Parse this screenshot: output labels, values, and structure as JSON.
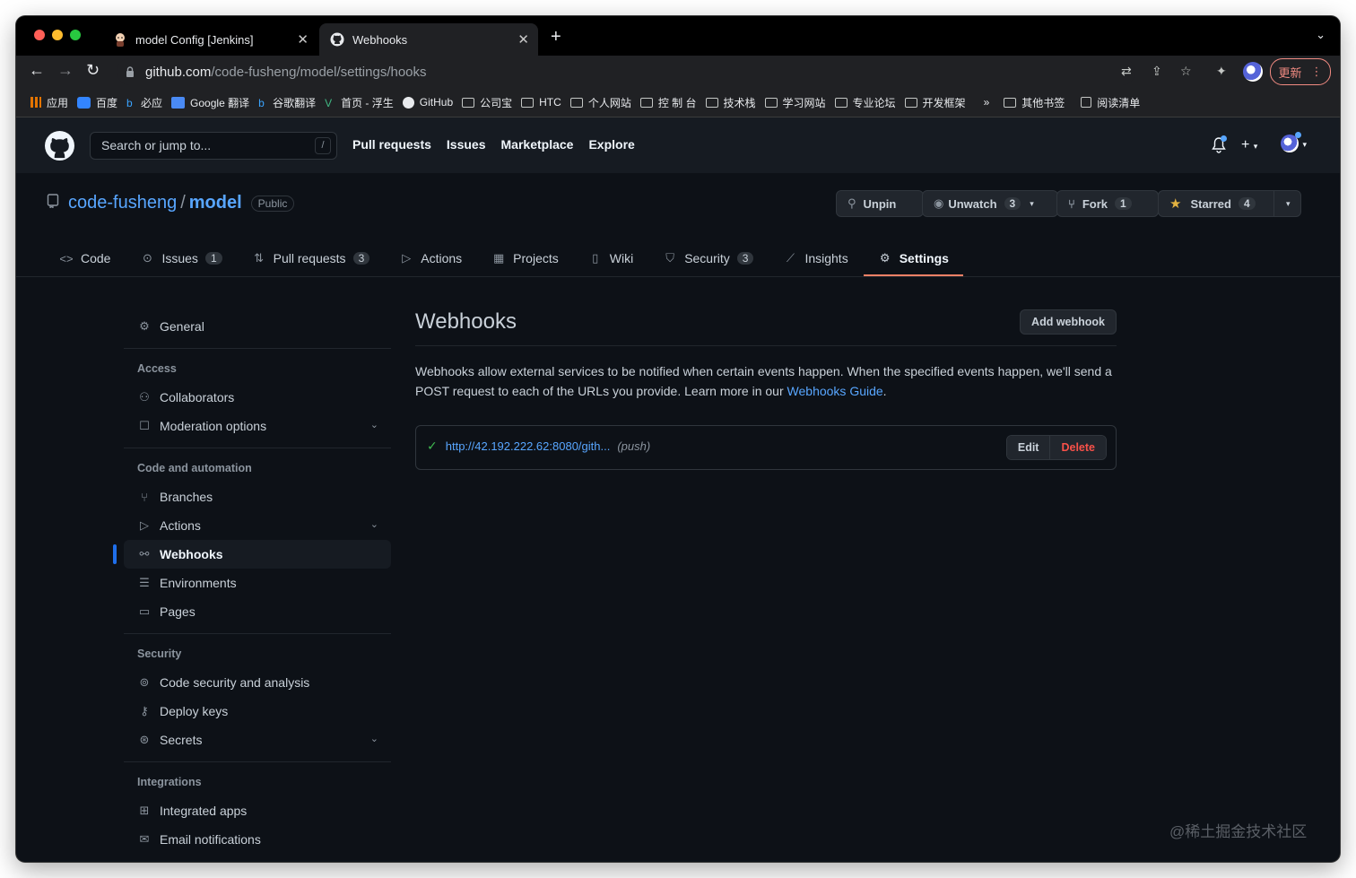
{
  "browser": {
    "tabs": [
      {
        "title": "model Config [Jenkins]",
        "icon": "jenkins-icon"
      },
      {
        "title": "Webhooks",
        "icon": "github-icon",
        "active": true
      }
    ],
    "url_host": "github.com",
    "url_path": "/code-fusheng/model/settings/hooks",
    "update_label": "更新",
    "bookmarks": [
      "应用",
      "百度",
      "必应",
      "Google 翻译",
      "谷歌翻译",
      "首页 - 浮生",
      "GitHub",
      "公司宝",
      "HTC",
      "个人网站",
      "控 制 台",
      "技术栈",
      "学习网站",
      "专业论坛",
      "开发框架"
    ],
    "bookmarks_overflow": "»",
    "other_bookmarks": "其他书签",
    "reading_list": "阅读清单"
  },
  "header": {
    "search_placeholder": "Search or jump to...",
    "search_key": "/",
    "nav": [
      "Pull requests",
      "Issues",
      "Marketplace",
      "Explore"
    ]
  },
  "repo": {
    "owner": "code-fusheng",
    "separator": "/",
    "name": "model",
    "visibility": "Public",
    "unpin_label": "Unpin",
    "watch_label": "Unwatch",
    "watch_count": "3",
    "fork_label": "Fork",
    "fork_count": "1",
    "star_label": "Starred",
    "star_count": "4",
    "tabs": [
      {
        "label": "Code",
        "count": ""
      },
      {
        "label": "Issues",
        "count": "1"
      },
      {
        "label": "Pull requests",
        "count": "3"
      },
      {
        "label": "Actions",
        "count": ""
      },
      {
        "label": "Projects",
        "count": ""
      },
      {
        "label": "Wiki",
        "count": ""
      },
      {
        "label": "Security",
        "count": "3"
      },
      {
        "label": "Insights",
        "count": ""
      },
      {
        "label": "Settings",
        "count": "",
        "selected": true
      }
    ]
  },
  "sidebar": {
    "general": "General",
    "access_heading": "Access",
    "access": [
      "Collaborators",
      "Moderation options"
    ],
    "code_heading": "Code and automation",
    "code": [
      "Branches",
      "Actions",
      "Webhooks",
      "Environments",
      "Pages"
    ],
    "security_heading": "Security",
    "security": [
      "Code security and analysis",
      "Deploy keys",
      "Secrets"
    ],
    "integrations_heading": "Integrations",
    "integrations": [
      "Integrated apps",
      "Email notifications"
    ]
  },
  "main": {
    "title": "Webhooks",
    "add_button": "Add webhook",
    "description": "Webhooks allow external services to be notified when certain events happen. When the specified events happen, we'll send a POST request to each of the URLs you provide. Learn more in our ",
    "guide_link": "Webhooks Guide",
    "description_end": ".",
    "hook_url": "http://42.192.222.62:8080/gith...",
    "hook_events": "(push)",
    "edit_label": "Edit",
    "delete_label": "Delete"
  },
  "watermark": "@稀土掘金技术社区",
  "colors": {
    "accent": "#58a6ff",
    "selected_underline": "#f78166",
    "delete": "#f85149",
    "success": "#3fb950",
    "background": "#0d1117"
  }
}
